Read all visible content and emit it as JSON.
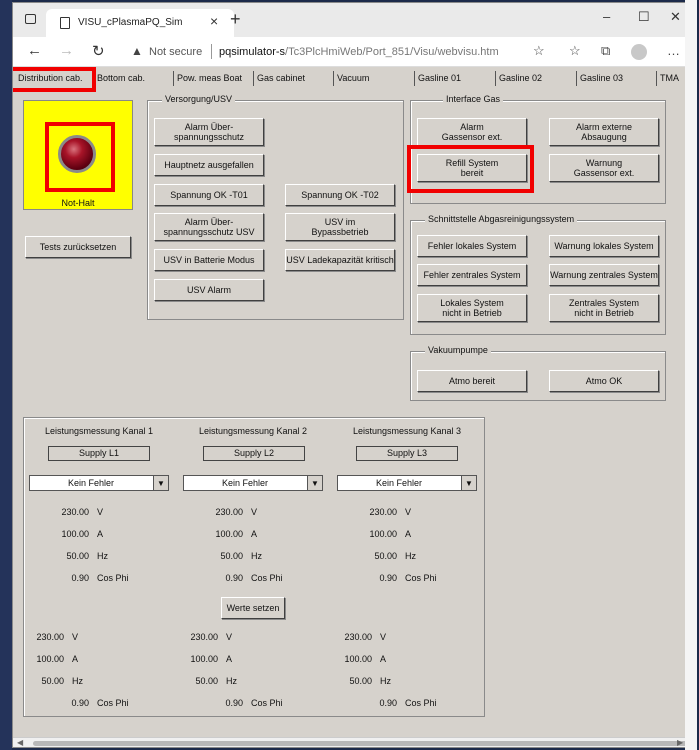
{
  "browser": {
    "tab_title": "VISU_cPlasmaPQ_Sim",
    "not_secure": "Not secure",
    "url_host": "pqsimulator-s",
    "url_path": "/Tc3PlcHmiWeb/Port_851/Visu/webvisu.htm"
  },
  "nav_tabs": [
    "Distribution cab.",
    "Bottom cab.",
    "Pow. meas Boat",
    "Gas cabinet",
    "Vacuum",
    "Gasline 01",
    "Gasline 02",
    "Gasline 03",
    "TMA"
  ],
  "notaus": {
    "label": "Not-Halt"
  },
  "reset_button": "Tests zurücksetzen",
  "versorgung": {
    "title": "Versorgung/USV",
    "buttons": [
      "Alarm Über-\nspannungsschutz",
      "Hauptnetz ausgefallen",
      "Spannung OK -T01",
      "Spannung OK -T02",
      "Alarm Über-\nspannungsschutz USV",
      "USV im\nBypassbetrieb",
      "USV in Batterie Modus",
      "USV Ladekapazität kritisch",
      "USV Alarm"
    ]
  },
  "interface_gas": {
    "title": "Interface Gas",
    "buttons": [
      "Alarm\nGassensor ext.",
      "Alarm externe\nAbsaugung",
      "Refill System\nbereit",
      "Warnung\nGassensor ext."
    ]
  },
  "abgas": {
    "title": "Schnittstelle Abgasreinigungssystem",
    "buttons": [
      "Fehler lokales System",
      "Warnung lokales System",
      "Fehler zentrales System",
      "Warnung zentrales System",
      "Lokales System\nnicht in Betrieb",
      "Zentrales System\nnicht in Betrieb"
    ]
  },
  "vakuum": {
    "title": "Vakuumpumpe",
    "buttons": [
      "Atmo bereit",
      "Atmo OK"
    ]
  },
  "leistung": {
    "channels": [
      {
        "title": "Leistungsmessung Kanal 1",
        "supply": "Supply L1",
        "select": "Kein Fehler"
      },
      {
        "title": "Leistungsmessung Kanal 2",
        "supply": "Supply L2",
        "select": "Kein Fehler"
      },
      {
        "title": "Leistungsmessung Kanal 3",
        "supply": "Supply L3",
        "select": "Kein Fehler"
      }
    ],
    "set_values": [
      "230.00",
      "100.00",
      "50.00",
      "0.90"
    ],
    "measured_values": [
      "230.00",
      "100.00",
      "50.00",
      "0.90"
    ],
    "units": [
      "V",
      "A",
      "Hz",
      "Cos Phi"
    ],
    "button": "Werte setzen"
  }
}
